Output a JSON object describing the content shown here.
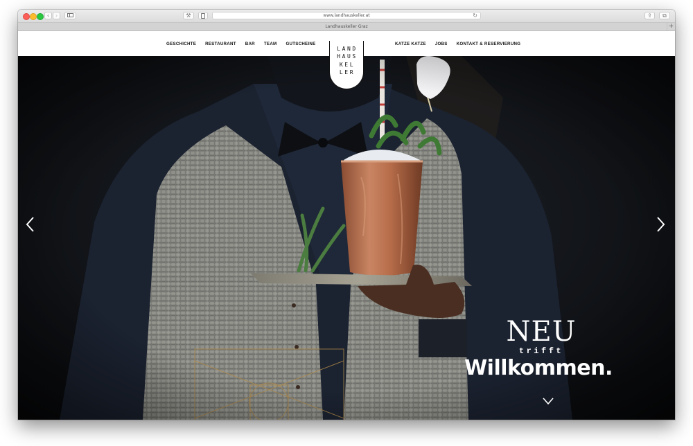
{
  "browser": {
    "url": "www.landhauskeller.at",
    "tab_title": "Landhauskeller Graz",
    "back_glyph": "‹",
    "forward_glyph": "›",
    "reload_glyph": "↻",
    "tab_add_glyph": "+",
    "wrench_glyph": "⚒",
    "share_glyph": "⇪",
    "tabs_glyph": "⧉"
  },
  "nav": {
    "left": [
      "GESCHICHTE",
      "RESTAURANT",
      "BAR",
      "TEAM",
      "GUTSCHEINE"
    ],
    "right": [
      "KATZE KATZE",
      "JOBS",
      "KONTAKT & RESERVIERUNG"
    ]
  },
  "logo": {
    "lines": [
      "LAND",
      "HAUS",
      "KEL",
      "LER"
    ]
  },
  "hero": {
    "headline_1": "NEU",
    "headline_2": "trifft",
    "headline_3": "Willkommen."
  },
  "icons": {
    "prev": "chevron-left-icon",
    "next": "chevron-right-icon",
    "down": "chevron-down-icon"
  },
  "colors": {
    "background": "#101216",
    "copper": "#b9704e",
    "text": "#ffffff",
    "traffic_red": "#fc5f57",
    "traffic_yellow": "#fdbc2e",
    "traffic_green": "#29c840"
  }
}
